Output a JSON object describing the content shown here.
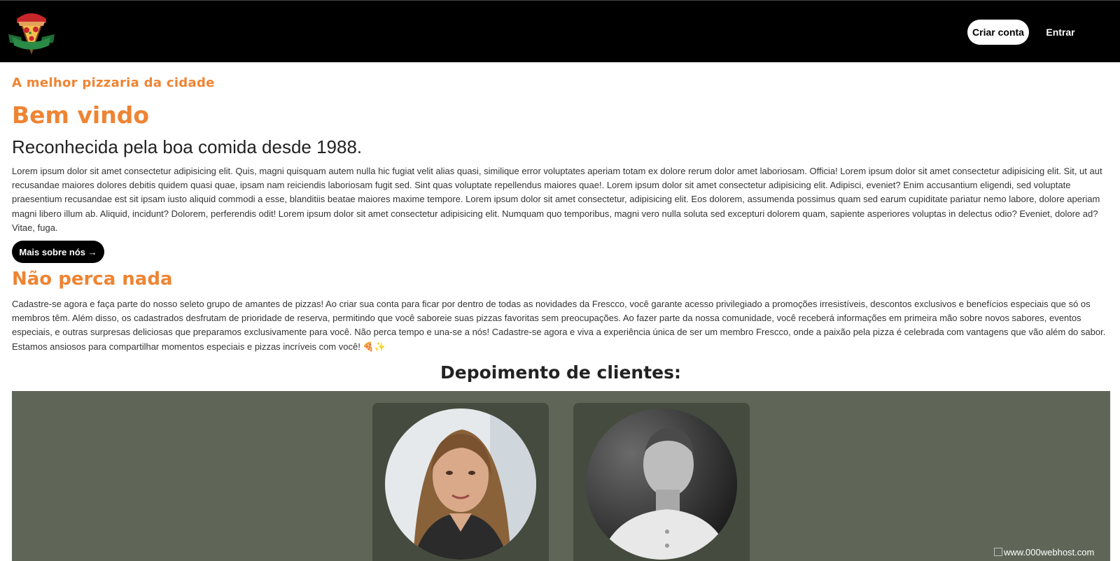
{
  "header": {
    "signup_label": "Criar conta",
    "login_label": "Entrar"
  },
  "hero": {
    "tagline": "A melhor pizzaria da cidade",
    "title": "Bem vindo",
    "subtitle": "Reconhecida pela boa comida desde 1988.",
    "paragraph": "Lorem ipsum dolor sit amet consectetur adipisicing elit. Quis, magni quisquam autem nulla hic fugiat velit alias quasi, similique error voluptates aperiam totam ex dolore rerum dolor amet laboriosam. Officia! Lorem ipsum dolor sit amet consectetur adipisicing elit. Sit, ut aut recusandae maiores dolores debitis quidem quasi quae, ipsam nam reiciendis laboriosam fugit sed. Sint quas voluptate repellendus maiores quae!. Lorem ipsum dolor sit amet consectetur adipisicing elit. Adipisci, eveniet? Enim accusantium eligendi, sed voluptate praesentium recusandae est sit ipsam iusto aliquid commodi a esse, blanditiis beatae maiores maxime tempore. Lorem ipsum dolor sit amet consectetur, adipisicing elit. Eos dolorem, assumenda possimus quam sed earum cupiditate pariatur nemo labore, dolore aperiam magni libero illum ab. Aliquid, incidunt? Dolorem, perferendis odit! Lorem ipsum dolor sit amet consectetur adipisicing elit. Numquam quo temporibus, magni vero nulla soluta sed excepturi dolorem quam, sapiente asperiores voluptas in delectus odio? Eveniet, dolore ad? Vitae, fuga.",
    "more_button": "Mais sobre nós →"
  },
  "signup_section": {
    "title": "Não perca nada",
    "paragraph": "Cadastre-se agora e faça parte do nosso seleto grupo de amantes de pizzas! Ao criar sua conta para ficar por dentro de todas as novidades da Frescco, você garante acesso privilegiado a promoções irresistíveis, descontos exclusivos e benefícios especiais que só os membros têm. Além disso, os cadastrados desfrutam de prioridade de reserva, permitindo que você saboreie suas pizzas favoritas sem preocupações. Ao fazer parte da nossa comunidade, você receberá informações em primeira mão sobre novos sabores, eventos especiais, e outras surpresas deliciosas que preparamos exclusivamente para você. Não perca tempo e una-se a nós! Cadastre-se agora e viva a experiência única de ser um membro Frescco, onde a paixão pela pizza é celebrada com vantagens que vão além do sabor. Estamos ansiosos para compartilhar momentos especiais e pizzas incríveis com você! 🍕✨"
  },
  "testimonials": {
    "title": "Depoimento de clientes:"
  },
  "footer_badge": {
    "text": "www.000webhost.com"
  },
  "colors": {
    "accent": "#ee8433",
    "topbar": "#000000",
    "testimonials_bg": "#5f6657",
    "card_bg": "#454b3e"
  }
}
